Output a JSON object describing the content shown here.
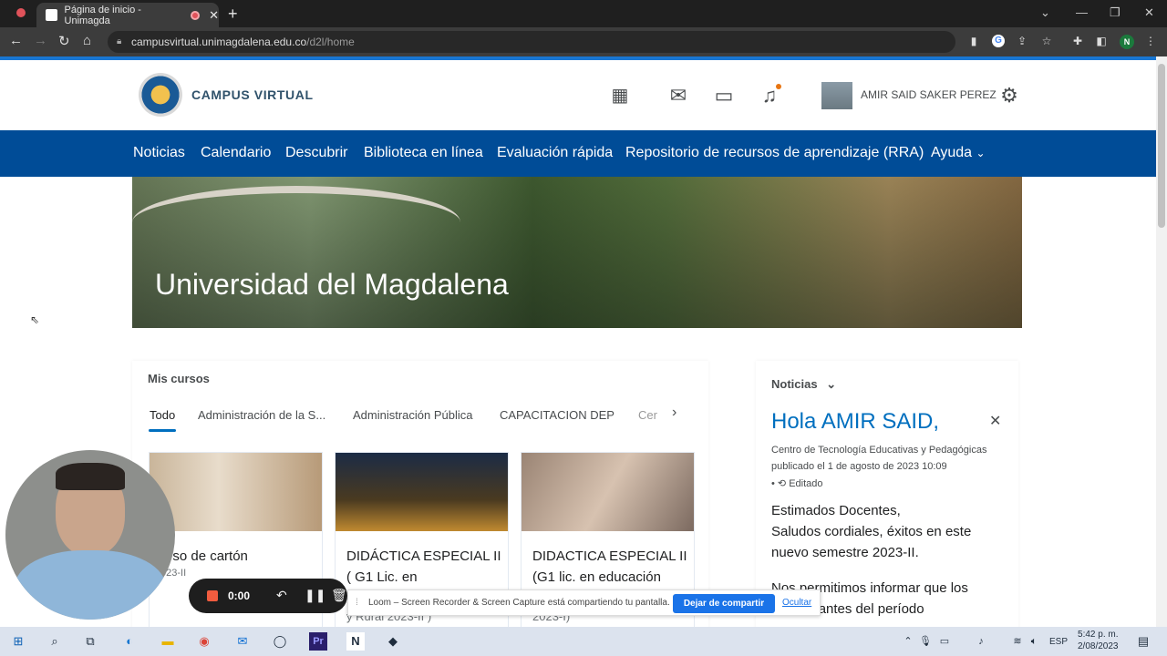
{
  "browser": {
    "tab_title": "Página de inicio - Unimagda",
    "new_tab": "+",
    "url_main": "campusvirtual.unimagdalena.edu.co",
    "url_path": "/d2l/home",
    "profile_initial": "N"
  },
  "header": {
    "brand": "CAMPUS VIRTUAL",
    "user_name": "AMIR SAID SAKER PEREZ"
  },
  "nav": {
    "items": [
      "Noticias",
      "Calendario",
      "Descubrir",
      "Biblioteca en línea",
      "Evaluación rápida",
      "Repositorio de recursos de aprendizaje (RRA)",
      "Ayuda"
    ]
  },
  "banner": {
    "title": "Universidad del Magdalena"
  },
  "courses": {
    "title": "Mis cursos",
    "tabs": [
      "Todo",
      "Administración de la S...",
      "Administración Pública",
      "CAPACITACION DEP",
      "Cer"
    ],
    "cards": [
      {
        "title": "urso de cartón",
        "sub": "023-II"
      },
      {
        "title": "DIDÁCTICA ESPECIAL II ( G1 Lic. en",
        "sub": "y Rural 2023-II )"
      },
      {
        "title": "DIDACTICA ESPECIAL II (G1 lic. en educación",
        "sub": "2023-I)"
      }
    ]
  },
  "news": {
    "title": "Noticias",
    "headline": "Hola AMIR SAID,",
    "author": "Centro de Tecnología Educativas y Pedagógicas",
    "published": "publicado el 1 de agosto de 2023 10:09",
    "edited": "Editado",
    "body1": "Estimados Docentes,",
    "body2": "Saludos cordiales, éxitos en este nuevo semestre 2023-II.",
    "body3": "Nos permitimos informar que los",
    "body4": "y estudiantes del período"
  },
  "loom": {
    "time": "0:00",
    "share_text": "Loom – Screen Recorder & Screen Capture está compartiendo tu pantalla.",
    "stop_share": "Dejar de compartir",
    "hide": "Ocultar"
  },
  "taskbar": {
    "lang": "ESP",
    "time": "5:42 p. m.",
    "date": "2/08/2023"
  },
  "colors": {
    "nav_blue": "#004c97",
    "link_blue": "#006fbf",
    "accent": "#1976d2"
  }
}
